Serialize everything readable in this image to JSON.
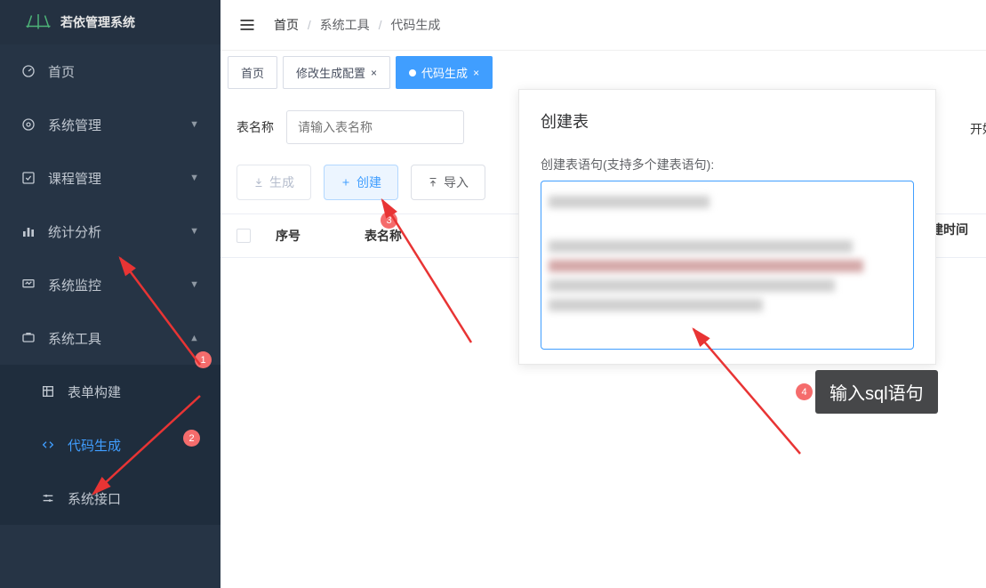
{
  "app_title": "若依管理系统",
  "breadcrumb": [
    "首页",
    "系统工具",
    "代码生成"
  ],
  "tabs": [
    {
      "label": "首页",
      "closable": false,
      "active": false
    },
    {
      "label": "修改生成配置",
      "closable": true,
      "active": false
    },
    {
      "label": "代码生成",
      "closable": true,
      "active": true
    }
  ],
  "sidebar": [
    {
      "icon": "dashboard",
      "label": "首页",
      "expandable": false
    },
    {
      "icon": "gear",
      "label": "系统管理",
      "expandable": true,
      "expanded": false
    },
    {
      "icon": "check",
      "label": "课程管理",
      "expandable": true,
      "expanded": false
    },
    {
      "icon": "chart",
      "label": "统计分析",
      "expandable": true,
      "expanded": false
    },
    {
      "icon": "monitor",
      "label": "系统监控",
      "expandable": true,
      "expanded": false
    },
    {
      "icon": "tool",
      "label": "系统工具",
      "expandable": true,
      "expanded": true,
      "children": [
        {
          "icon": "form",
          "label": "表单构建",
          "active": false
        },
        {
          "icon": "code",
          "label": "代码生成",
          "active": true
        },
        {
          "icon": "sliders",
          "label": "系统接口",
          "active": false
        }
      ]
    }
  ],
  "filter": {
    "label": "表名称",
    "placeholder": "请输入表名称"
  },
  "far_label": "开好",
  "buttons": {
    "generate": "生成",
    "create": "创建",
    "import": "导入"
  },
  "table": {
    "cols": [
      "序号",
      "表名称"
    ],
    "last_col": "建时间"
  },
  "dialog": {
    "title": "创建表",
    "label": "创建表语句(支持多个建表语句):"
  },
  "annotations": {
    "badges": [
      "1",
      "2",
      "3",
      "4"
    ],
    "tooltip": "输入sql语句"
  }
}
